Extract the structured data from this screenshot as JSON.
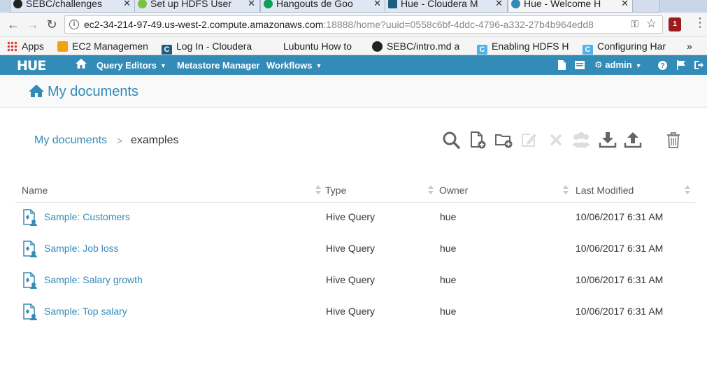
{
  "browser": {
    "tabs": [
      {
        "title": "SEBC/challenges",
        "icon": "github-icon"
      },
      {
        "title": "Set up HDFS User",
        "icon": "hadoop-icon"
      },
      {
        "title": "Hangouts de Goo",
        "icon": "hangouts-icon"
      },
      {
        "title": "Hue - Cloudera M",
        "icon": "cloudera-icon"
      },
      {
        "title": "Hue - Welcome H",
        "icon": "hue-icon"
      }
    ],
    "url_host": "ec2-34-214-97-49.us-west-2.compute.amazonaws.com",
    "url_rest": ":18888/home?uuid=0558c6bf-4ddc-4796-a332-27b4b964edd8",
    "extension_badge": "1",
    "bookmarks": [
      {
        "label": "Apps",
        "icon": "apps-grid-icon"
      },
      {
        "label": "EC2 Managemen",
        "icon": "aws-box-icon"
      },
      {
        "label": "Log In - Cloudera",
        "icon": "cloudera-icon"
      },
      {
        "label": "Lubuntu How to",
        "icon": "lubuntu-icon"
      },
      {
        "label": "SEBC/intro.md a",
        "icon": "github-icon"
      },
      {
        "label": "Enabling HDFS H",
        "icon": "cloudera-light-icon"
      },
      {
        "label": "Configuring Har",
        "icon": "cloudera-light-icon"
      }
    ],
    "more_bookmarks": "»"
  },
  "hue": {
    "logo": "HUE",
    "nav": [
      {
        "label": "Query Editors",
        "caret": true
      },
      {
        "label": "Metastore Manager",
        "caret": false
      },
      {
        "label": "Workflows",
        "caret": true
      }
    ],
    "user": "admin",
    "accent": "#338bb8"
  },
  "page": {
    "title": "My documents",
    "breadcrumb": {
      "root": "My documents",
      "separator": ">",
      "current": "examples"
    }
  },
  "table": {
    "columns": [
      "Name",
      "Type",
      "Owner",
      "Last Modified"
    ],
    "rows": [
      {
        "name": "Sample: Customers",
        "type": "Hive Query",
        "owner": "hue",
        "modified": "10/06/2017 6:31 AM"
      },
      {
        "name": "Sample: Job loss",
        "type": "Hive Query",
        "owner": "hue",
        "modified": "10/06/2017 6:31 AM"
      },
      {
        "name": "Sample: Salary growth",
        "type": "Hive Query",
        "owner": "hue",
        "modified": "10/06/2017 6:31 AM"
      },
      {
        "name": "Sample: Top salary",
        "type": "Hive Query",
        "owner": "hue",
        "modified": "10/06/2017 6:31 AM"
      }
    ]
  }
}
